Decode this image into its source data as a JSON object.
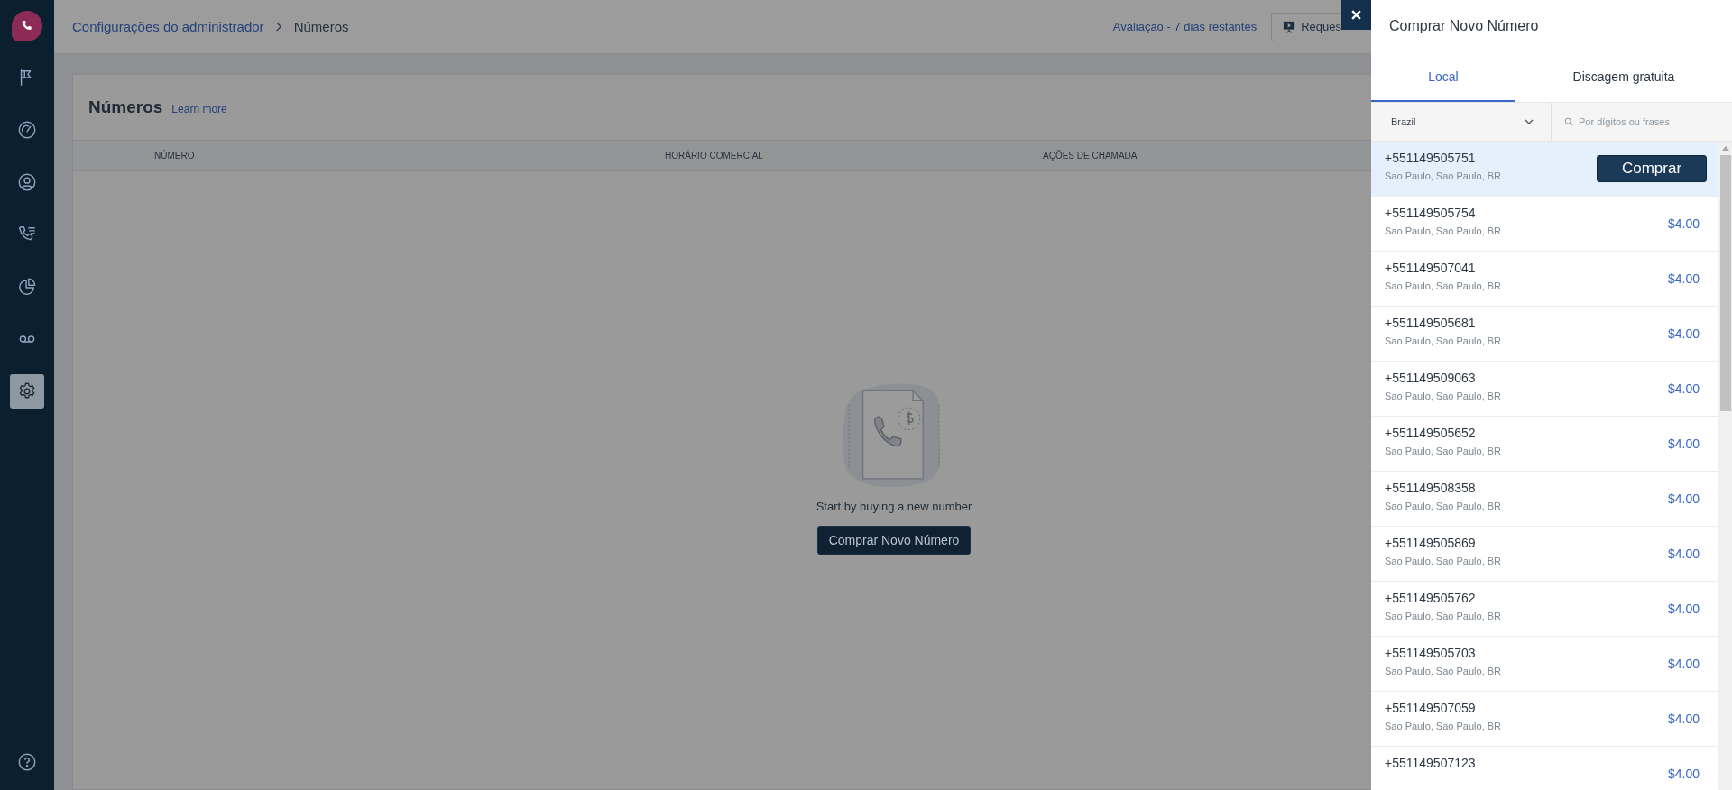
{
  "sidebar": {
    "items": [
      {
        "selected": false
      },
      {
        "selected": false
      },
      {
        "selected": false
      },
      {
        "selected": false
      },
      {
        "selected": false
      },
      {
        "selected": false
      },
      {
        "selected": true
      }
    ]
  },
  "breadcrumb": {
    "items": [
      "Configurações do administrador",
      "Números"
    ]
  },
  "header": {
    "trial": "Avaliação - 7 dias restantes",
    "button": "Reques"
  },
  "page": {
    "title": "Números",
    "link": "Learn more",
    "columns": [
      "NÚMERO",
      "HORÁRIO COMERCIAL",
      "AÇÕES DE CHAMADA"
    ],
    "empty": {
      "message": "Start by buying a new number",
      "button": "Comprar Novo Número"
    }
  },
  "panel": {
    "title": "Comprar Novo Número",
    "tabs": [
      {
        "label": "Local",
        "selected": true
      },
      {
        "label": "Discagem gratuita",
        "selected": false
      }
    ],
    "country": "Brazil",
    "search": {
      "placeholder": "Por dígitos ou frases"
    },
    "buy_button": "Comprar",
    "numbers": [
      {
        "number": "+551149505751",
        "location": "Sao Paulo, Sao Paulo, BR",
        "selected": true
      },
      {
        "number": "+551149505754",
        "location": "Sao Paulo, Sao Paulo, BR",
        "price": "$4.00",
        "selected": false
      },
      {
        "number": "+551149507041",
        "location": "Sao Paulo, Sao Paulo, BR",
        "price": "$4.00",
        "selected": false
      },
      {
        "number": "+551149505681",
        "location": "Sao Paulo, Sao Paulo, BR",
        "price": "$4.00",
        "selected": false
      },
      {
        "number": "+551149509063",
        "location": "Sao Paulo, Sao Paulo, BR",
        "price": "$4.00",
        "selected": false
      },
      {
        "number": "+551149505652",
        "location": "Sao Paulo, Sao Paulo, BR",
        "price": "$4.00",
        "selected": false
      },
      {
        "number": "+551149508358",
        "location": "Sao Paulo, Sao Paulo, BR",
        "price": "$4.00",
        "selected": false
      },
      {
        "number": "+551149505869",
        "location": "Sao Paulo, Sao Paulo, BR",
        "price": "$4.00",
        "selected": false
      },
      {
        "number": "+551149505762",
        "location": "Sao Paulo, Sao Paulo, BR",
        "price": "$4.00",
        "selected": false
      },
      {
        "number": "+551149505703",
        "location": "Sao Paulo, Sao Paulo, BR",
        "price": "$4.00",
        "selected": false
      },
      {
        "number": "+551149507059",
        "location": "Sao Paulo, Sao Paulo, BR",
        "price": "$4.00",
        "selected": false
      },
      {
        "number": "+551149507123",
        "price": "$4.00",
        "selected": false
      }
    ]
  }
}
